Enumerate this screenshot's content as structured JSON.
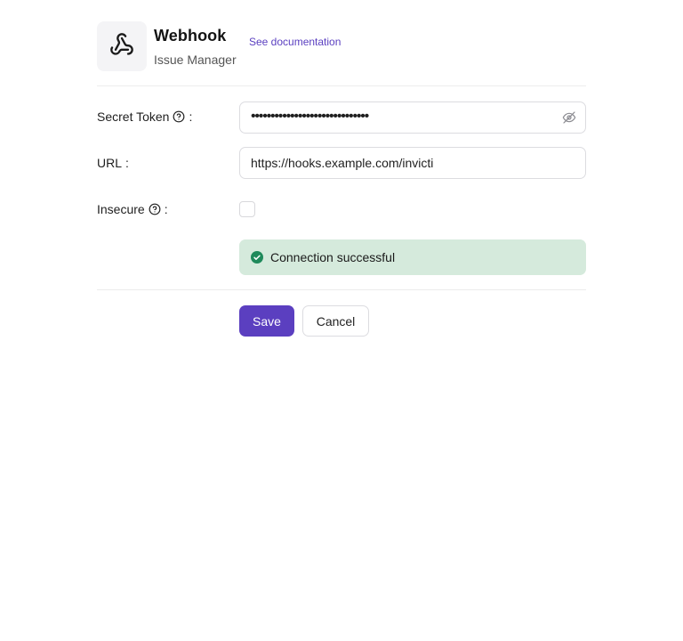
{
  "header": {
    "title": "Webhook",
    "subtitle": "Issue Manager",
    "doc_link": "See documentation",
    "logo_icon": "webhook-icon"
  },
  "form": {
    "secret_token": {
      "label": "Secret Token",
      "suffix": ":",
      "value_masked": "••••••••••••••••••••••••••••••",
      "help_icon": "help-circle-icon",
      "visibility_icon": "eye-off-icon"
    },
    "url": {
      "label": "URL",
      "suffix": ":",
      "value": "https://hooks.example.com/invicti"
    },
    "insecure": {
      "label": "Insecure",
      "suffix": ":",
      "checked": false,
      "help_icon": "help-circle-icon"
    }
  },
  "status": {
    "message": "Connection successful",
    "icon": "check-circle-icon",
    "color": "#1f8a5b",
    "background": "#d5eadc"
  },
  "actions": {
    "save_label": "Save",
    "cancel_label": "Cancel",
    "primary_color": "#5b3fc0"
  }
}
